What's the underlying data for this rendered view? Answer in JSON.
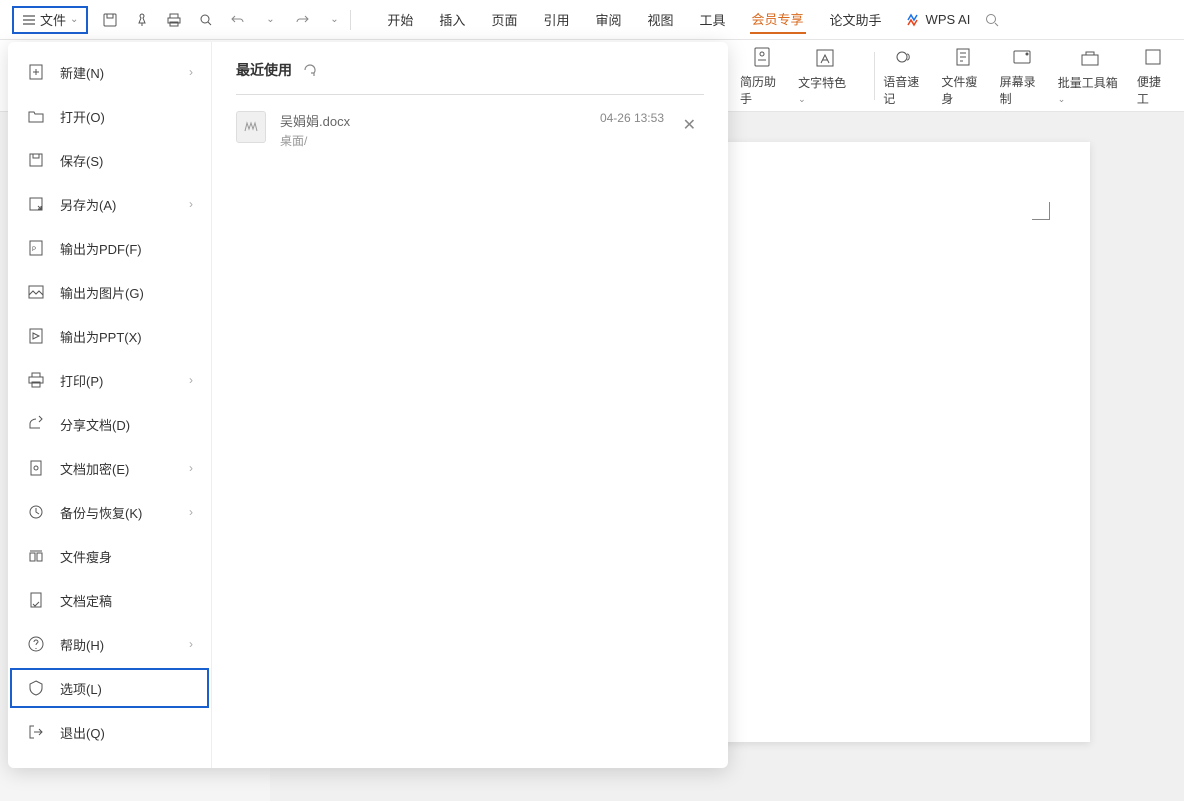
{
  "topbar": {
    "file_label": "文件",
    "tabs": [
      "开始",
      "插入",
      "页面",
      "引用",
      "审阅",
      "视图",
      "工具",
      "会员专享",
      "论文助手"
    ],
    "active_tab": "会员专享",
    "wps_ai": "WPS AI"
  },
  "ribbon": {
    "items": [
      {
        "label": "简历助手"
      },
      {
        "label": "文字特色"
      },
      {
        "label": "语音速记"
      },
      {
        "label": "文件瘦身"
      },
      {
        "label": "屏幕录制"
      },
      {
        "label": "批量工具箱"
      },
      {
        "label": "便捷工"
      }
    ]
  },
  "file_menu": {
    "items": [
      {
        "label": "新建(N)",
        "arrow": true,
        "icon": "new"
      },
      {
        "label": "打开(O)",
        "arrow": false,
        "icon": "open"
      },
      {
        "label": "保存(S)",
        "arrow": false,
        "icon": "save"
      },
      {
        "label": "另存为(A)",
        "arrow": true,
        "icon": "saveas"
      },
      {
        "label": "输出为PDF(F)",
        "arrow": false,
        "icon": "pdf"
      },
      {
        "label": "输出为图片(G)",
        "arrow": false,
        "icon": "image"
      },
      {
        "label": "输出为PPT(X)",
        "arrow": false,
        "icon": "ppt"
      },
      {
        "label": "打印(P)",
        "arrow": true,
        "icon": "print"
      },
      {
        "label": "分享文档(D)",
        "arrow": false,
        "icon": "share"
      },
      {
        "label": "文档加密(E)",
        "arrow": true,
        "icon": "encrypt"
      },
      {
        "label": "备份与恢复(K)",
        "arrow": true,
        "icon": "backup"
      },
      {
        "label": "文件瘦身",
        "arrow": false,
        "icon": "slim"
      },
      {
        "label": "文档定稿",
        "arrow": false,
        "icon": "final"
      },
      {
        "label": "帮助(H)",
        "arrow": true,
        "icon": "help"
      },
      {
        "label": "选项(L)",
        "arrow": false,
        "icon": "options",
        "highlight": true
      },
      {
        "label": "退出(Q)",
        "arrow": false,
        "icon": "exit"
      }
    ]
  },
  "recent": {
    "title": "最近使用",
    "items": [
      {
        "name": "吴娟娟.docx",
        "path": "桌面/",
        "time": "04-26 13:53"
      }
    ]
  }
}
